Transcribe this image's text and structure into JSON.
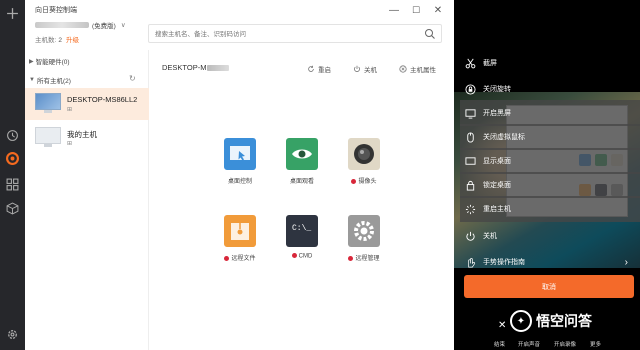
{
  "window": {
    "title": "向日葵控制端",
    "min": "—",
    "max": "☐",
    "close": "✕"
  },
  "user": {
    "vip_label": "(免费版)",
    "chevron": "∨",
    "host_count_label": "主机数:",
    "host_count": "2",
    "upgrade": "升级"
  },
  "search": {
    "placeholder": "搜索主机名、备注、识别码访问"
  },
  "groups": [
    {
      "label": "智能硬件(0)"
    },
    {
      "label": "所有主机(2)"
    }
  ],
  "devices": [
    {
      "name": "DESKTOP-MS86LL2",
      "os": "⊞"
    },
    {
      "name": "我的主机",
      "os": "⊞"
    }
  ],
  "detail": {
    "hostname": "DESKTOP-M",
    "actions": [
      {
        "label": "重启"
      },
      {
        "label": "关机"
      },
      {
        "label": "主机属性"
      }
    ]
  },
  "tiles": [
    {
      "label": "桌面控制",
      "dot": false,
      "color": "#3b8fd9"
    },
    {
      "label": "桌面观看",
      "dot": false,
      "color": "#37a266"
    },
    {
      "label": "摄像头",
      "dot": true,
      "color": "#d8d0bf"
    },
    {
      "label": "远程文件",
      "dot": true,
      "color": "#f19b3a"
    },
    {
      "label": "CMD",
      "dot": true,
      "color": "#2e3440"
    },
    {
      "label": "远程管理",
      "dot": true,
      "color": "#9a9a9a"
    }
  ],
  "overlay": {
    "menu": [
      {
        "label": "截屏"
      },
      {
        "label": "关闭旋转"
      },
      {
        "label": "开启黑屏"
      },
      {
        "label": "关闭虚拟鼠标"
      },
      {
        "label": "显示桌面"
      },
      {
        "label": "锁定桌面"
      },
      {
        "label": "重启主机"
      },
      {
        "label": "关机"
      },
      {
        "label": "手势操作指南"
      }
    ],
    "cancel": "取消",
    "bottom": [
      "结束",
      "开启声音",
      "开启录像",
      "更多"
    ],
    "watermark": "悟空问答"
  },
  "colors": {
    "accent": "#f56a1f",
    "rail": "#26272b",
    "selected": "#fdebdd"
  }
}
